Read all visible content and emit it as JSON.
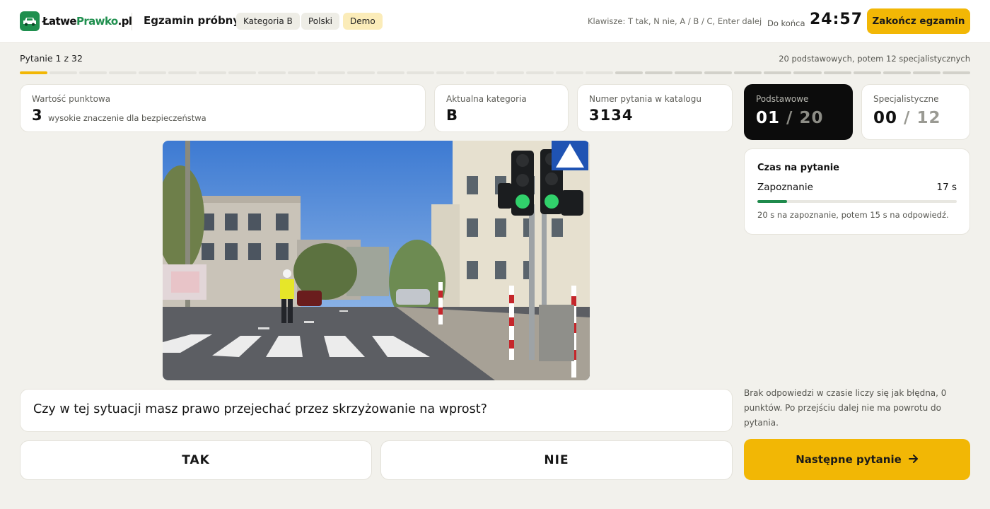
{
  "header": {
    "logo": {
      "text_main": "Łatwe",
      "text_accent": "Prawko",
      "text_suffix": ".pl",
      "icon": "car-icon"
    },
    "title": "Egzamin próbny",
    "chips": [
      "Kategoria B",
      "Polski",
      "Demo"
    ],
    "keys_hint": "Klawisze: T tak, N nie, A / B / C, Enter dalej",
    "remaining_label": "Do końca",
    "timer": "24:57",
    "finish_button": "Zakończ egzamin"
  },
  "progress": {
    "counter": "Pytanie 1 z 32",
    "structure": "20 podstawowych, potem 12 specjalistycznych",
    "total": 32,
    "basic": 20,
    "current": 1
  },
  "info_cards": {
    "points": {
      "label": "Wartość punktowa",
      "value": "3",
      "sub": "wysokie znaczenie dla bezpieczeństwa"
    },
    "category": {
      "label": "Aktualna kategoria",
      "value": "B"
    },
    "catalog": {
      "label": "Numer pytania w katalogu",
      "value": "3134"
    }
  },
  "counters": {
    "basic": {
      "label": "Podstawowe",
      "current": "01",
      "separator": "/",
      "total": "20"
    },
    "special": {
      "label": "Specjalistyczne",
      "current": "00",
      "separator": "/",
      "total": "12"
    }
  },
  "time_panel": {
    "title": "Czas na pytanie",
    "phase": "Zapoznanie",
    "seconds": "17 s",
    "elapsed_fraction": 0.15,
    "note": "20 s na zapoznanie, potem 15 s na odpowiedź."
  },
  "question": {
    "text": "Czy w tej sytuacji masz prawo przejechać przez skrzyżowanie na wprost?"
  },
  "answers": {
    "yes": "TAK",
    "no": "NIE"
  },
  "rules_note": "Brak odpowiedzi w czasie liczy się jak błędna, 0 punktów. Po przejściu dalej nie ma powrotu do pytania.",
  "next_button": {
    "label": "Następne pytanie",
    "icon": "arrow-right-icon"
  },
  "colors": {
    "accent": "#f2b705",
    "brand_green": "#1f8f4e",
    "background": "#f2f1ec",
    "dark_card": "#0c0c0c"
  }
}
